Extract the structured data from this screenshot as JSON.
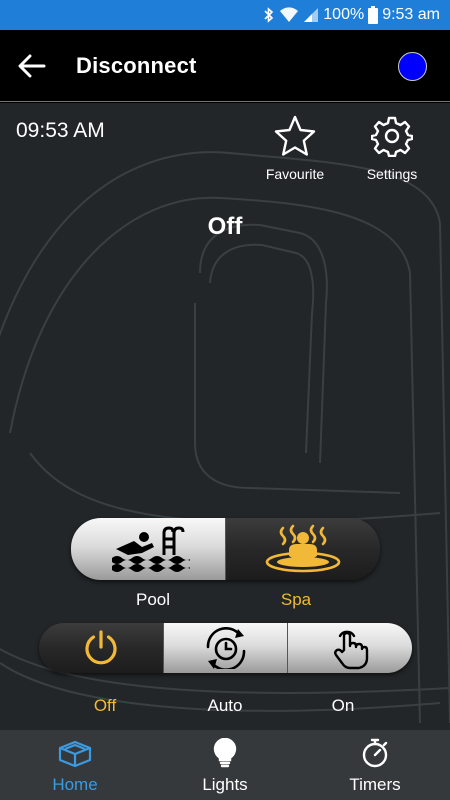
{
  "status_bar": {
    "battery": "100%",
    "time": "9:53 am"
  },
  "app_bar": {
    "title": "Disconnect",
    "connection_color": "#0000ff"
  },
  "main": {
    "clock": "09:53 AM",
    "favourite_label": "Favourite",
    "settings_label": "Settings",
    "mode_status": "Off"
  },
  "body_select": {
    "options": [
      {
        "label": "Pool",
        "icon": "swimmer-icon",
        "selected": false
      },
      {
        "label": "Spa",
        "icon": "spa-icon",
        "selected": true
      }
    ]
  },
  "pump_mode": {
    "options": [
      {
        "label": "Off",
        "icon": "power-icon",
        "selected": true
      },
      {
        "label": "Auto",
        "icon": "auto-clock-icon",
        "selected": false
      },
      {
        "label": "On",
        "icon": "touch-icon",
        "selected": false
      }
    ]
  },
  "bottom_nav": {
    "items": [
      {
        "label": "Home",
        "icon": "hot-tub-icon",
        "active": true
      },
      {
        "label": "Lights",
        "icon": "light-bulb-icon",
        "active": false
      },
      {
        "label": "Timers",
        "icon": "stopwatch-icon",
        "active": false
      }
    ]
  },
  "colors": {
    "accent": "#f2b838",
    "active_nav": "#3b9ae0",
    "status_bar": "#1f7fd8"
  }
}
